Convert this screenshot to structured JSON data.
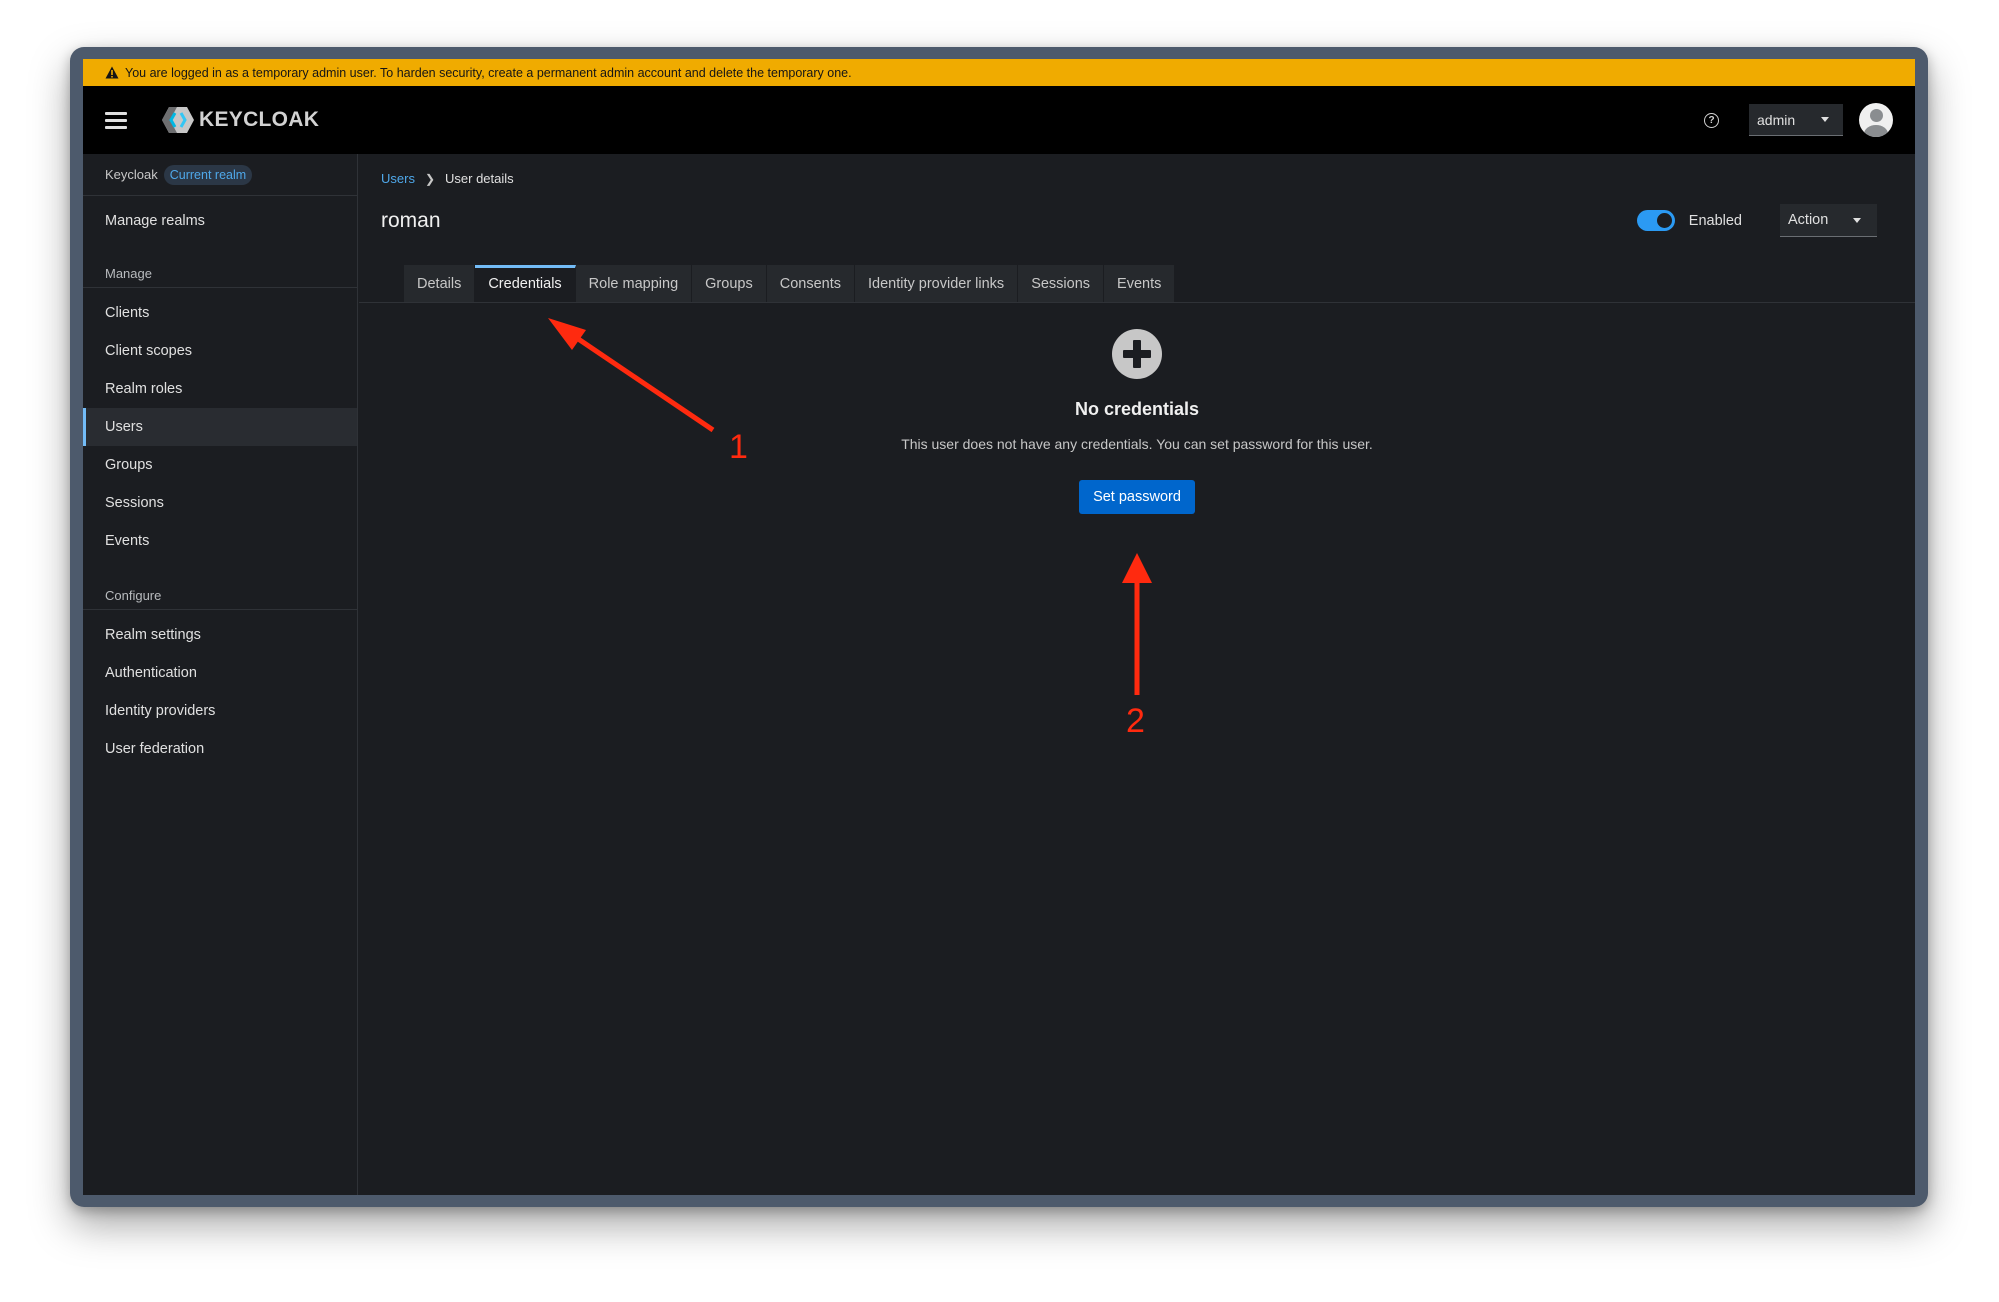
{
  "banner": {
    "text": "You are logged in as a temporary admin user. To harden security, create a permanent admin account and delete the temporary one."
  },
  "masthead": {
    "logo_text": "KEYCLOAK",
    "user_menu_label": "admin"
  },
  "sidebar": {
    "realm_name": "Keycloak",
    "realm_badge": "Current realm",
    "manage_realms": "Manage realms",
    "manage_section": "Manage",
    "manage_items": [
      "Clients",
      "Client scopes",
      "Realm roles",
      "Users",
      "Groups",
      "Sessions",
      "Events"
    ],
    "active_item": "Users",
    "configure_section": "Configure",
    "configure_items": [
      "Realm settings",
      "Authentication",
      "Identity providers",
      "User federation"
    ]
  },
  "breadcrumb": {
    "parent": "Users",
    "current": "User details"
  },
  "page": {
    "title": "roman",
    "enabled_label": "Enabled",
    "enabled": true,
    "action_label": "Action"
  },
  "tabs": [
    "Details",
    "Credentials",
    "Role mapping",
    "Groups",
    "Consents",
    "Identity provider links",
    "Sessions",
    "Events"
  ],
  "active_tab": "Credentials",
  "empty_state": {
    "title": "No credentials",
    "body": "This user does not have any credentials. You can set password for this user.",
    "button": "Set password"
  },
  "annotations": {
    "arrow_1_label": "1",
    "arrow_2_label": "2",
    "color": "#ff2a0f"
  }
}
